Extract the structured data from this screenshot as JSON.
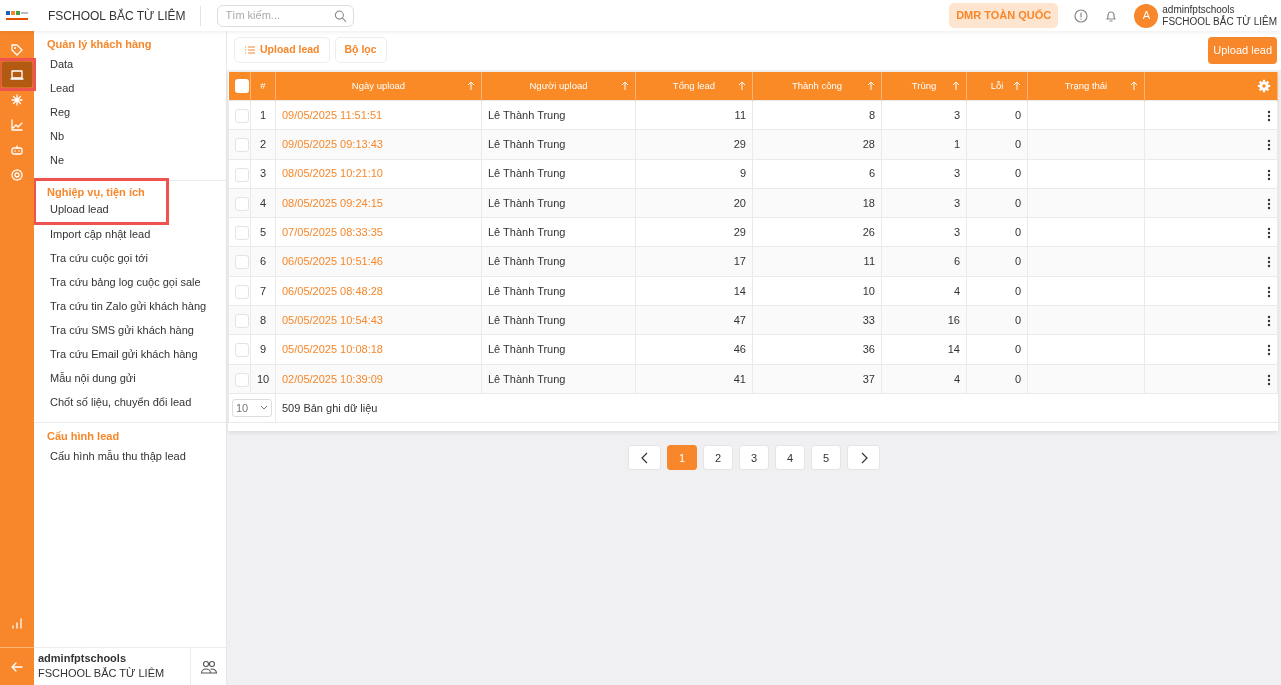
{
  "topbar": {
    "title": "FSCHOOL BẮC TỪ LIÊM",
    "search": {
      "placeholder": "Tìm kiếm..."
    },
    "region_button": "DMR TOÀN QUỐC",
    "user": {
      "avatar": "A",
      "name": "adminfptschools",
      "org": "FSCHOOL BẮC TỪ LIÊM"
    }
  },
  "rail": {
    "items": [
      {
        "kind": "tag",
        "selected": false,
        "highlighted": false
      },
      {
        "kind": "laptop",
        "selected": true,
        "highlighted": true
      },
      {
        "kind": "network",
        "selected": false,
        "highlighted": false
      },
      {
        "kind": "chart",
        "selected": false,
        "highlighted": false
      },
      {
        "kind": "robot",
        "selected": false,
        "highlighted": false
      },
      {
        "kind": "gear",
        "selected": false,
        "highlighted": false
      }
    ]
  },
  "sidebar": {
    "sections": [
      {
        "title": "Quản lý khách hàng",
        "highlighted": false,
        "items": [
          {
            "label": "Data",
            "highlighted": false
          },
          {
            "label": "Lead",
            "highlighted": false
          },
          {
            "label": "Reg",
            "highlighted": false
          },
          {
            "label": "Nb",
            "highlighted": false
          },
          {
            "label": "Ne",
            "highlighted": false
          }
        ]
      },
      {
        "title": "Nghiệp vụ, tiện ích",
        "highlighted": true,
        "items": [
          {
            "label": "Upload lead",
            "highlighted": true
          },
          {
            "label": "Import cập nhật lead",
            "highlighted": false
          },
          {
            "label": "Tra cứu cuộc gọi tới",
            "highlighted": false
          },
          {
            "label": "Tra cứu bảng log cuộc gọi sale",
            "highlighted": false
          },
          {
            "label": "Tra cứu tin Zalo gửi khách hàng",
            "highlighted": false
          },
          {
            "label": "Tra cứu SMS gửi khách hàng",
            "highlighted": false
          },
          {
            "label": "Tra cứu Email gửi khách hàng",
            "highlighted": false
          },
          {
            "label": "Mẫu nội dung gửi",
            "highlighted": false
          },
          {
            "label": "Chốt số liệu, chuyển đổi lead",
            "highlighted": false
          }
        ]
      },
      {
        "title": "Cấu hình lead",
        "highlighted": false,
        "items": [
          {
            "label": "Cấu hình mẫu thu thập lead",
            "highlighted": false
          }
        ]
      }
    ],
    "footer": {
      "name": "adminfptschools",
      "org": "FSCHOOL BẮC TỪ LIÊM"
    }
  },
  "toolbar": {
    "buttons": [
      {
        "label": "Upload lead",
        "kind": "list"
      },
      {
        "label": "Bộ lọc",
        "kind": "plain"
      }
    ],
    "primary_button": "Upload lead"
  },
  "table": {
    "header_checked": false,
    "columns": [
      {
        "label": "#",
        "sortable": false
      },
      {
        "label": "Ngày upload",
        "sortable": true
      },
      {
        "label": "Người upload",
        "sortable": true
      },
      {
        "label": "Tổng lead",
        "sortable": true
      },
      {
        "label": "Thành công",
        "sortable": true
      },
      {
        "label": "Trùng",
        "sortable": true
      },
      {
        "label": "Lỗi",
        "sortable": true
      },
      {
        "label": "Trạng thái",
        "sortable": true
      }
    ],
    "rows": [
      {
        "checked": false,
        "cells": [
          "1",
          "09/05/2025 11:51:51",
          "Lê Thành Trung",
          "11",
          "8",
          "3",
          "0",
          ""
        ]
      },
      {
        "checked": false,
        "cells": [
          "2",
          "09/05/2025 09:13:43",
          "Lê Thành Trung",
          "29",
          "28",
          "1",
          "0",
          ""
        ]
      },
      {
        "checked": false,
        "cells": [
          "3",
          "08/05/2025 10:21:10",
          "Lê Thành Trung",
          "9",
          "6",
          "3",
          "0",
          ""
        ]
      },
      {
        "checked": false,
        "cells": [
          "4",
          "08/05/2025 09:24:15",
          "Lê Thành Trung",
          "20",
          "18",
          "3",
          "0",
          ""
        ]
      },
      {
        "checked": false,
        "cells": [
          "5",
          "07/05/2025 08:33:35",
          "Lê Thành Trung",
          "29",
          "26",
          "3",
          "0",
          ""
        ]
      },
      {
        "checked": false,
        "cells": [
          "6",
          "06/05/2025 10:51:46",
          "Lê Thành Trung",
          "17",
          "11",
          "6",
          "0",
          ""
        ]
      },
      {
        "checked": false,
        "cells": [
          "7",
          "06/05/2025 08:48:28",
          "Lê Thành Trung",
          "14",
          "10",
          "4",
          "0",
          ""
        ]
      },
      {
        "checked": false,
        "cells": [
          "8",
          "05/05/2025 10:54:43",
          "Lê Thành Trung",
          "47",
          "33",
          "16",
          "0",
          ""
        ]
      },
      {
        "checked": false,
        "cells": [
          "9",
          "05/05/2025 10:08:18",
          "Lê Thành Trung",
          "46",
          "36",
          "14",
          "0",
          ""
        ]
      },
      {
        "checked": false,
        "cells": [
          "10",
          "02/05/2025 10:39:09",
          "Lê Thành Trung",
          "41",
          "37",
          "4",
          "0",
          ""
        ]
      }
    ],
    "page_size": "10",
    "total": "509 Bản ghi dữ liệu"
  },
  "pagination": {
    "pages": [
      {
        "label": "1",
        "selected": true
      },
      {
        "label": "2",
        "selected": false
      },
      {
        "label": "3",
        "selected": false
      },
      {
        "label": "4",
        "selected": false
      },
      {
        "label": "5",
        "selected": false
      }
    ]
  }
}
